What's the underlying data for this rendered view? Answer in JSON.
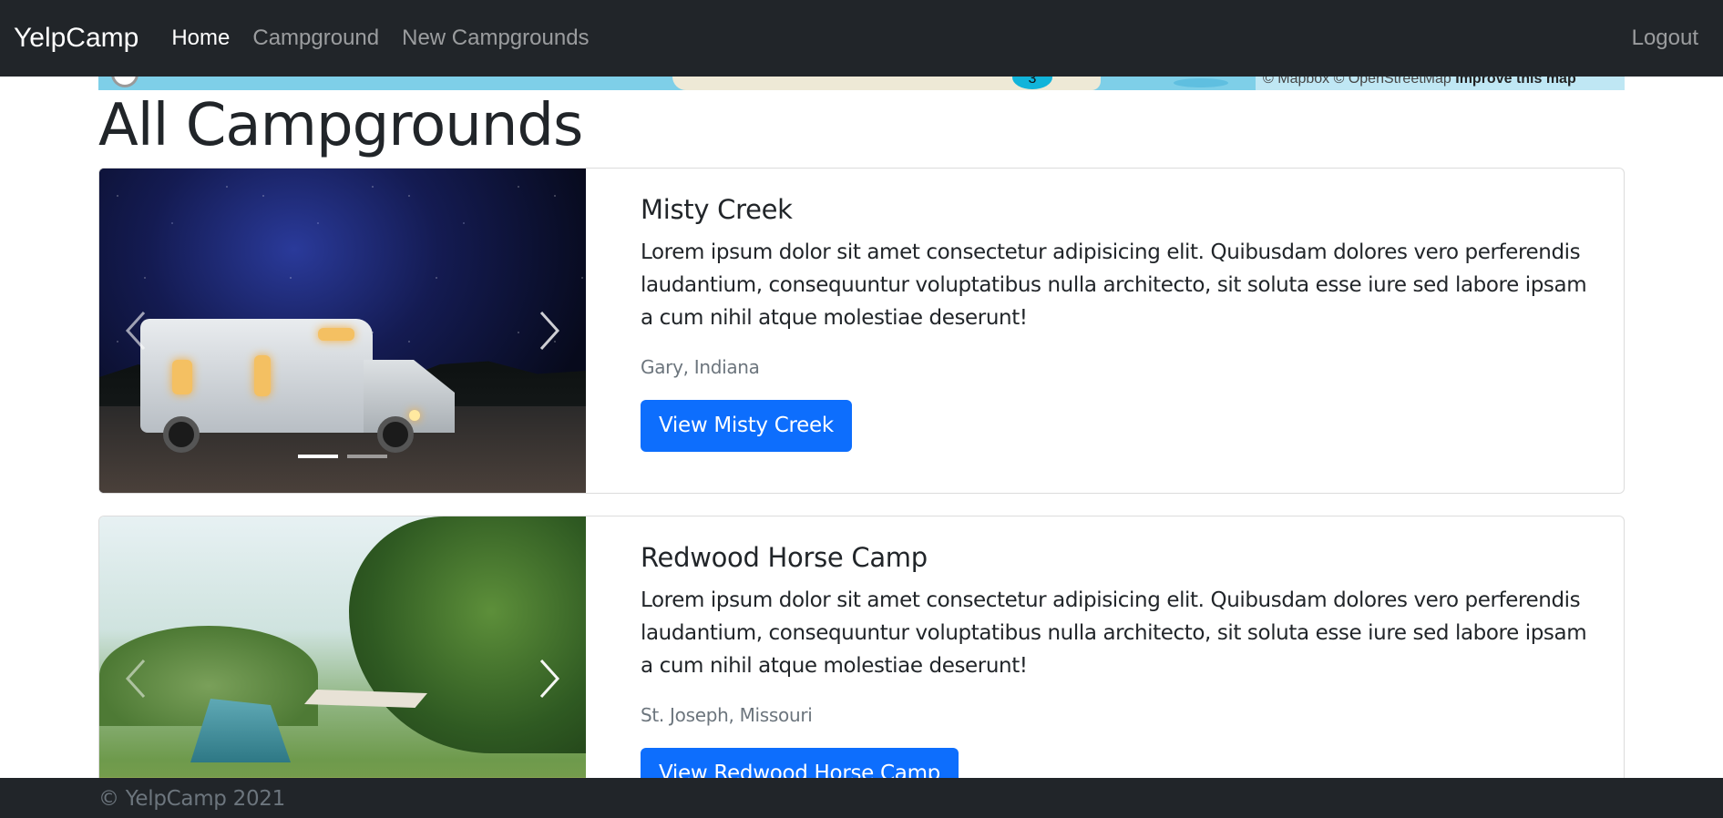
{
  "navbar": {
    "brand": "YelpCamp",
    "links": [
      {
        "label": "Home",
        "active": true
      },
      {
        "label": "Campground",
        "active": false
      },
      {
        "label": "New Campgrounds",
        "active": false
      }
    ],
    "logout_label": "Logout"
  },
  "map": {
    "cluster_count": "3",
    "attribution": "© Mapbox © OpenStreetMap",
    "improve_label": "Improve this map"
  },
  "page": {
    "title": "All Campgrounds"
  },
  "campgrounds": [
    {
      "title": "Misty Creek",
      "description": "Lorem ipsum dolor sit amet consectetur adipisicing elit. Quibusdam dolores vero perferendis laudantium, consequuntur voluptatibus nulla architecto, sit soluta esse iure sed labore ipsam a cum nihil atque molestiae deserunt!",
      "location": "Gary, Indiana",
      "button_label": "View Misty Creek",
      "image_count": 2,
      "active_image": 1
    },
    {
      "title": "Redwood Horse Camp",
      "description": "Lorem ipsum dolor sit amet consectetur adipisicing elit. Quibusdam dolores vero perferendis laudantium, consequuntur voluptatibus nulla architecto, sit soluta esse iure sed labore ipsam a cum nihil atque molestiae deserunt!",
      "location": "St. Joseph, Missouri",
      "button_label": "View Redwood Horse Camp"
    }
  ],
  "footer": {
    "text": "© YelpCamp 2021"
  },
  "colors": {
    "navbar_bg": "#212529",
    "primary": "#0d6efd",
    "muted": "#6c757d"
  }
}
